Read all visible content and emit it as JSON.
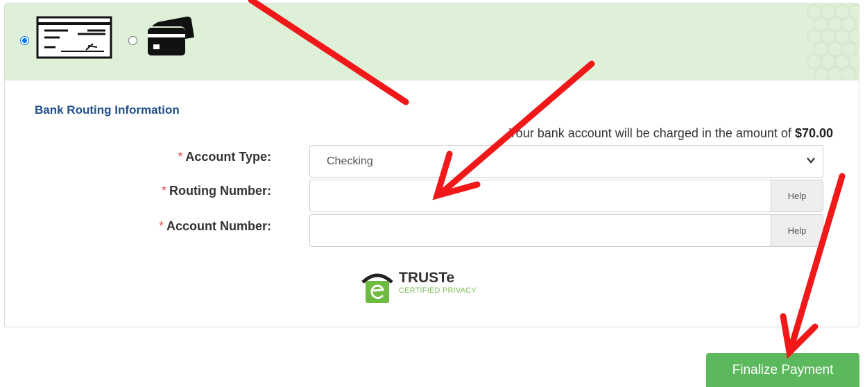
{
  "payment_methods": [
    {
      "name": "bank-check",
      "icon": "check-icon",
      "selected": true
    },
    {
      "name": "credit-card",
      "icon": "credit-card-icon",
      "selected": false
    }
  ],
  "section": {
    "title": "Bank Routing Information",
    "charge_prefix": "Your bank account will be charged in the amount of ",
    "charge_amount": "$70.00"
  },
  "form": {
    "required_marker": "*",
    "account_type": {
      "label": "Account Type:",
      "value": "Checking"
    },
    "routing_number": {
      "label": "Routing Number:",
      "value": "",
      "help_label": "Help"
    },
    "account_number": {
      "label": "Account Number:",
      "value": "",
      "help_label": "Help"
    }
  },
  "badge": {
    "brand": "TRUSTe",
    "subtitle": "CERTIFIED PRIVACY"
  },
  "actions": {
    "finalize_label": "Finalize Payment"
  },
  "colors": {
    "method_bar": "#dff0d8",
    "title": "#1f4e8c",
    "required": "#d9534f",
    "button": "#5cb85c",
    "annotation_arrow": "#f01818"
  }
}
